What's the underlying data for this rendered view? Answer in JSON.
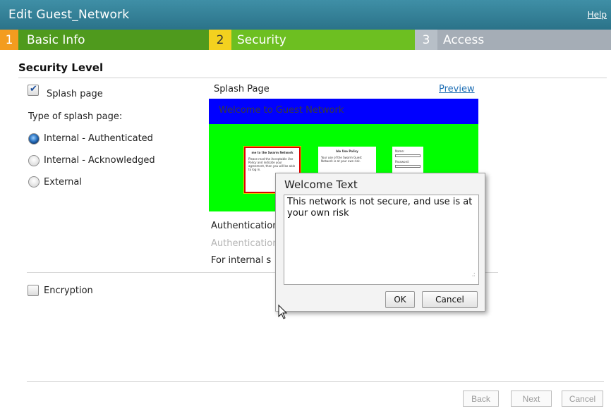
{
  "header": {
    "title": "Edit Guest_Network",
    "help": "Help"
  },
  "tabs": [
    {
      "num": "1",
      "label": "Basic Info"
    },
    {
      "num": "2",
      "label": "Security"
    },
    {
      "num": "3",
      "label": "Access"
    }
  ],
  "section": {
    "title": "Security Level"
  },
  "left": {
    "splash_label": "Splash page",
    "splash_checked": true,
    "type_label": "Type of splash page:",
    "options": [
      "Internal - Authenticated",
      "Internal - Acknowledged",
      "External"
    ],
    "selected_option": "Internal - Authenticated",
    "encryption_label": "Encryption",
    "encryption_checked": false
  },
  "splash": {
    "label": "Splash Page",
    "preview_link": "Preview",
    "banner": "Welcome to Guest Network",
    "mini1_title": "me to the Swarm Network",
    "mini1_body": "Please read the Acceptable Use Policy and indicate your agreement, then you will be able to log in.",
    "mini2_title": "ble Use Policy",
    "mini2_body": "Your use of the Swarm Guest Network is at your own risk.",
    "mini3_name": "Name:",
    "mini3_password": "Password:"
  },
  "auth": {
    "row1": "Authentication",
    "row2": "Authentication",
    "row3": "For internal s"
  },
  "dialog": {
    "title": "Welcome Text",
    "text": "This network is not secure, and use is at your own risk",
    "ok": "OK",
    "cancel": "Cancel"
  },
  "footer": {
    "back": "Back",
    "next": "Next",
    "cancel": "Cancel"
  },
  "colors": {
    "titlebar": "#2f7d94",
    "tab1_num": "#f39c1f",
    "tab1": "#4f9a1d",
    "tab2_num": "#f3d11f",
    "tab2": "#6dbf21",
    "tab3": "#a5adb6",
    "splash_banner": "#0000ff",
    "splash_bg": "#00ff00"
  }
}
